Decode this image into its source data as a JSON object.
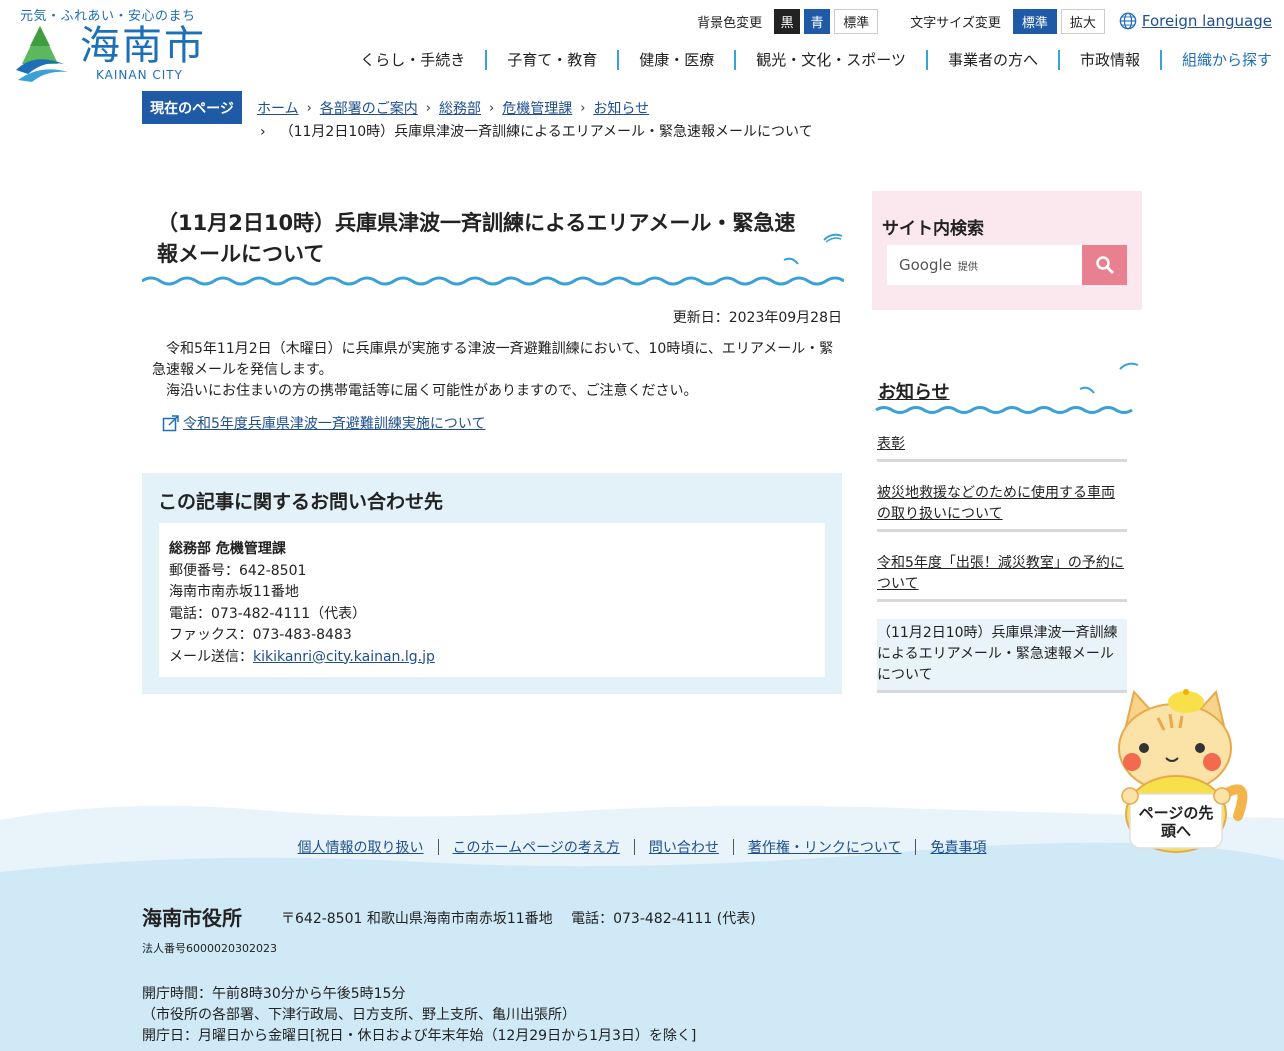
{
  "header": {
    "tagline": "元気・ふれあい・安心のまち",
    "logo_name": "海南市",
    "logo_en": "KAINAN CITY",
    "bg_label": "背景色変更",
    "bg_black": "黒",
    "bg_blue": "青",
    "bg_standard": "標準",
    "font_label": "文字サイズ変更",
    "font_standard": "標準",
    "font_large": "拡大",
    "foreign": "Foreign language",
    "nav": [
      "くらし・手続き",
      "子育て・教育",
      "健康・医療",
      "観光・文化・スポーツ",
      "事業者の方へ",
      "市政情報",
      "組織から探す"
    ]
  },
  "breadcrumb": {
    "label": "現在のページ",
    "items": [
      "ホーム",
      "各部署のご案内",
      "総務部",
      "危機管理課",
      "お知らせ"
    ],
    "current": "（11月2日10時）兵庫県津波一斉訓練によるエリアメール・緊急速報メールについて"
  },
  "article": {
    "title": "（11月2日10時）兵庫県津波一斉訓練によるエリアメール・緊急速報メールについて",
    "updated": "更新日：2023年09月28日",
    "paragraphs": [
      "令和5年11月2日（木曜日）に兵庫県が実施する津波一斉避難訓練において、10時頃に、エリアメール・緊急速報メールを発信します。",
      "海沿いにお住まいの方の携帯電話等に届く可能性がありますので、ご注意ください。"
    ],
    "link": "令和5年度兵庫県津波一斉避難訓練実施について"
  },
  "contact": {
    "heading": "この記事に関するお問い合わせ先",
    "dept": "総務部 危機管理課",
    "postal": "郵便番号：642-8501",
    "address": "海南市南赤坂11番地",
    "phone": "電話：073-482-4111（代表）",
    "fax": "ファックス：073-483-8483",
    "mail_label": "メール送信：",
    "mail": "kikikanri@city.kainan.lg.jp"
  },
  "sidebar": {
    "search_title": "サイト内検索",
    "search_google": "Google",
    "search_provided": "提供",
    "news_title": "お知らせ",
    "news": [
      "表彰",
      "被災地救援などのために使用する車両の取り扱いについて",
      "令和5年度「出張！減災教室」の予約について",
      "（11月2日10時）兵庫県津波一斉訓練によるエリアメール・緊急速報メールについて"
    ]
  },
  "mascot": {
    "text": "ページの先頭へ"
  },
  "footer": {
    "links": [
      "個人情報の取り扱い",
      "このホームページの考え方",
      "問い合わせ",
      "著作権・リンクについて",
      "免責事項"
    ],
    "org": "海南市役所",
    "address": "〒642-8501 和歌山県海南市南赤坂11番地　 電話：073-482-4111 (代表)",
    "corp_no": "法人番号6000020302023",
    "hours": "開庁時間：午前8時30分から午後5時15分",
    "hours_note": "（市役所の各部署、下津行政局、日方支所、野上支所、亀川出張所）",
    "days": "開庁日：月曜日から金曜日[祝日・休日および年末年始（12月29日から1月3日）を除く]"
  },
  "colors": {
    "accent": "#1f5aa6",
    "wave": "#3aa0d8",
    "contact_bg": "#e3f1f8",
    "search_bg": "#fbe8ee",
    "search_btn": "#e8808f",
    "footer_bg": "#cfe9f6"
  }
}
